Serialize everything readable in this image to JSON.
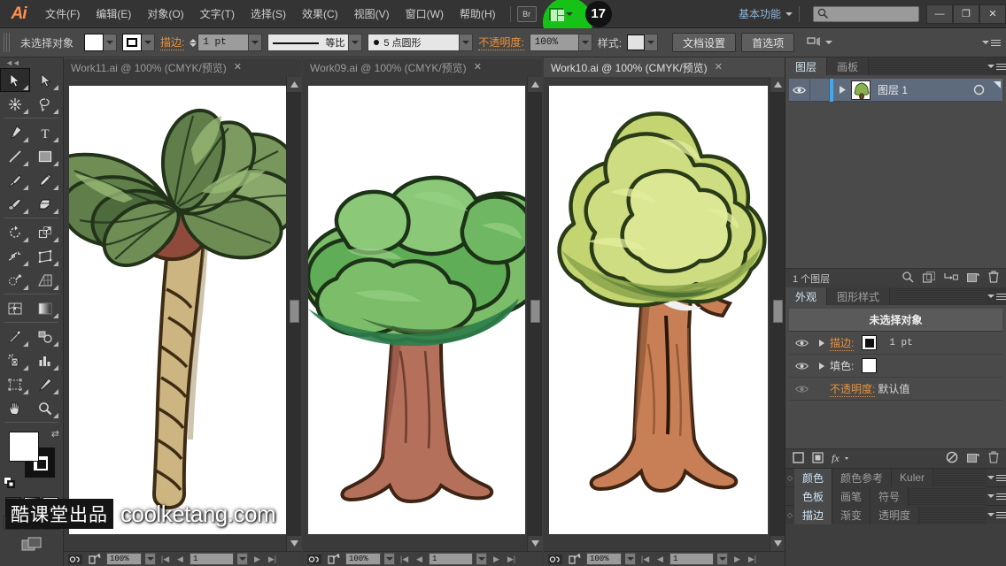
{
  "app": {
    "logo": "Ai"
  },
  "menubar": {
    "items": [
      {
        "label": "文件(F)"
      },
      {
        "label": "编辑(E)"
      },
      {
        "label": "对象(O)"
      },
      {
        "label": "文字(T)"
      },
      {
        "label": "选择(S)"
      },
      {
        "label": "效果(C)"
      },
      {
        "label": "视图(V)"
      },
      {
        "label": "窗口(W)"
      },
      {
        "label": "帮助(H)"
      }
    ],
    "bridge_label": "Br",
    "badge_count": "17",
    "workspace": "基本功能",
    "search_placeholder": "",
    "search_value": "",
    "window_buttons": {
      "minimize": "—",
      "maximize": "❐",
      "close": "✕"
    }
  },
  "controlbar": {
    "selection_status": "未选择对象",
    "stroke_label": "描边:",
    "stroke_weight": "1 pt",
    "profile_label": "等比",
    "brush_label": "5 点圆形",
    "opacity_label": "不透明度:",
    "opacity_value": "100%",
    "style_label": "样式:",
    "doc_setup_button": "文档设置",
    "preferences_button": "首选项"
  },
  "toolbar": {
    "tools": [
      {
        "name": "selection-tool",
        "label": "选择工具"
      },
      {
        "name": "direct-selection-tool",
        "label": "直接选择工具"
      },
      {
        "name": "magic-wand-tool",
        "label": "魔棒工具"
      },
      {
        "name": "lasso-tool",
        "label": "套索工具"
      },
      {
        "name": "pen-tool",
        "label": "钢笔工具"
      },
      {
        "name": "type-tool",
        "label": "文字工具"
      },
      {
        "name": "line-segment-tool",
        "label": "直线段工具"
      },
      {
        "name": "rectangle-tool",
        "label": "矩形工具"
      },
      {
        "name": "paintbrush-tool",
        "label": "画笔工具"
      },
      {
        "name": "pencil-tool",
        "label": "铅笔工具"
      },
      {
        "name": "blob-brush-tool",
        "label": "斑点画笔工具"
      },
      {
        "name": "eraser-tool",
        "label": "橡皮擦工具"
      },
      {
        "name": "rotate-tool",
        "label": "旋转工具"
      },
      {
        "name": "scale-tool",
        "label": "比例缩放工具"
      },
      {
        "name": "width-tool",
        "label": "宽度工具"
      },
      {
        "name": "free-transform-tool",
        "label": "自由变换工具"
      },
      {
        "name": "shape-builder-tool",
        "label": "形状生成器工具"
      },
      {
        "name": "perspective-grid-tool",
        "label": "透视网格工具"
      },
      {
        "name": "mesh-tool",
        "label": "网格工具"
      },
      {
        "name": "gradient-tool",
        "label": "渐变工具"
      },
      {
        "name": "eyedropper-tool",
        "label": "吸管工具"
      },
      {
        "name": "blend-tool",
        "label": "混合工具"
      },
      {
        "name": "symbol-sprayer-tool",
        "label": "符号喷枪工具"
      },
      {
        "name": "column-graph-tool",
        "label": "柱形图工具"
      },
      {
        "name": "artboard-tool",
        "label": "画板工具"
      },
      {
        "name": "slice-tool",
        "label": "切片工具"
      },
      {
        "name": "hand-tool",
        "label": "抓手工具"
      },
      {
        "name": "zoom-tool",
        "label": "缩放工具"
      }
    ]
  },
  "documents": [
    {
      "tab_title": "Work11.ai @ 100% (CMYK/预览)",
      "active": false,
      "artwork": "palm-tree",
      "status": {
        "zoom": "100%",
        "page": "1"
      }
    },
    {
      "tab_title": "Work09.ai @ 100% (CMYK/预览)",
      "active": false,
      "artwork": "broadleaf-tree",
      "status": {
        "zoom": "100%",
        "page": "1"
      }
    },
    {
      "tab_title": "Work10.ai @ 100% (CMYK/预览)",
      "active": true,
      "artwork": "oak-tree",
      "status": {
        "zoom": "100%",
        "page": "1"
      }
    }
  ],
  "layers_panel": {
    "tabs": [
      {
        "label": "图层",
        "active": true
      },
      {
        "label": "画板",
        "active": false
      }
    ],
    "layer": {
      "name": "图层 1"
    },
    "footer_count": "1 个图层"
  },
  "appearance_panel": {
    "tabs": [
      {
        "label": "外观",
        "active": true
      },
      {
        "label": "图形样式",
        "active": false
      }
    ],
    "header": "未选择对象",
    "rows": [
      {
        "label": "描边:",
        "value": "1 pt",
        "swatch": "#ffffff",
        "accent": true
      },
      {
        "label": "填色:",
        "value": "",
        "swatch": "#ffffff",
        "accent": false
      },
      {
        "label": "不透明度:",
        "value": "默认值",
        "swatch": "",
        "accent": true
      }
    ]
  },
  "collapsed_panels": [
    {
      "tabs": [
        {
          "label": "颜色",
          "active": true
        },
        {
          "label": "颜色参考",
          "active": false
        },
        {
          "label": "Kuler",
          "active": false
        }
      ],
      "grip": true
    },
    {
      "tabs": [
        {
          "label": "色板",
          "active": true
        },
        {
          "label": "画笔",
          "active": false
        },
        {
          "label": "符号",
          "active": false
        }
      ],
      "grip": false
    },
    {
      "tabs": [
        {
          "label": "描边",
          "active": true
        },
        {
          "label": "渐变",
          "active": false
        },
        {
          "label": "透明度",
          "active": false
        }
      ],
      "grip": true
    }
  ],
  "watermark": {
    "cn": "酷课堂出品",
    "en": "coolketang.com"
  },
  "colors": {
    "accent_orange": "#e8913c",
    "highlight_green": "#16c215",
    "panel_bg": "#3e3e3e",
    "layer_row": "#5d6b7d"
  }
}
